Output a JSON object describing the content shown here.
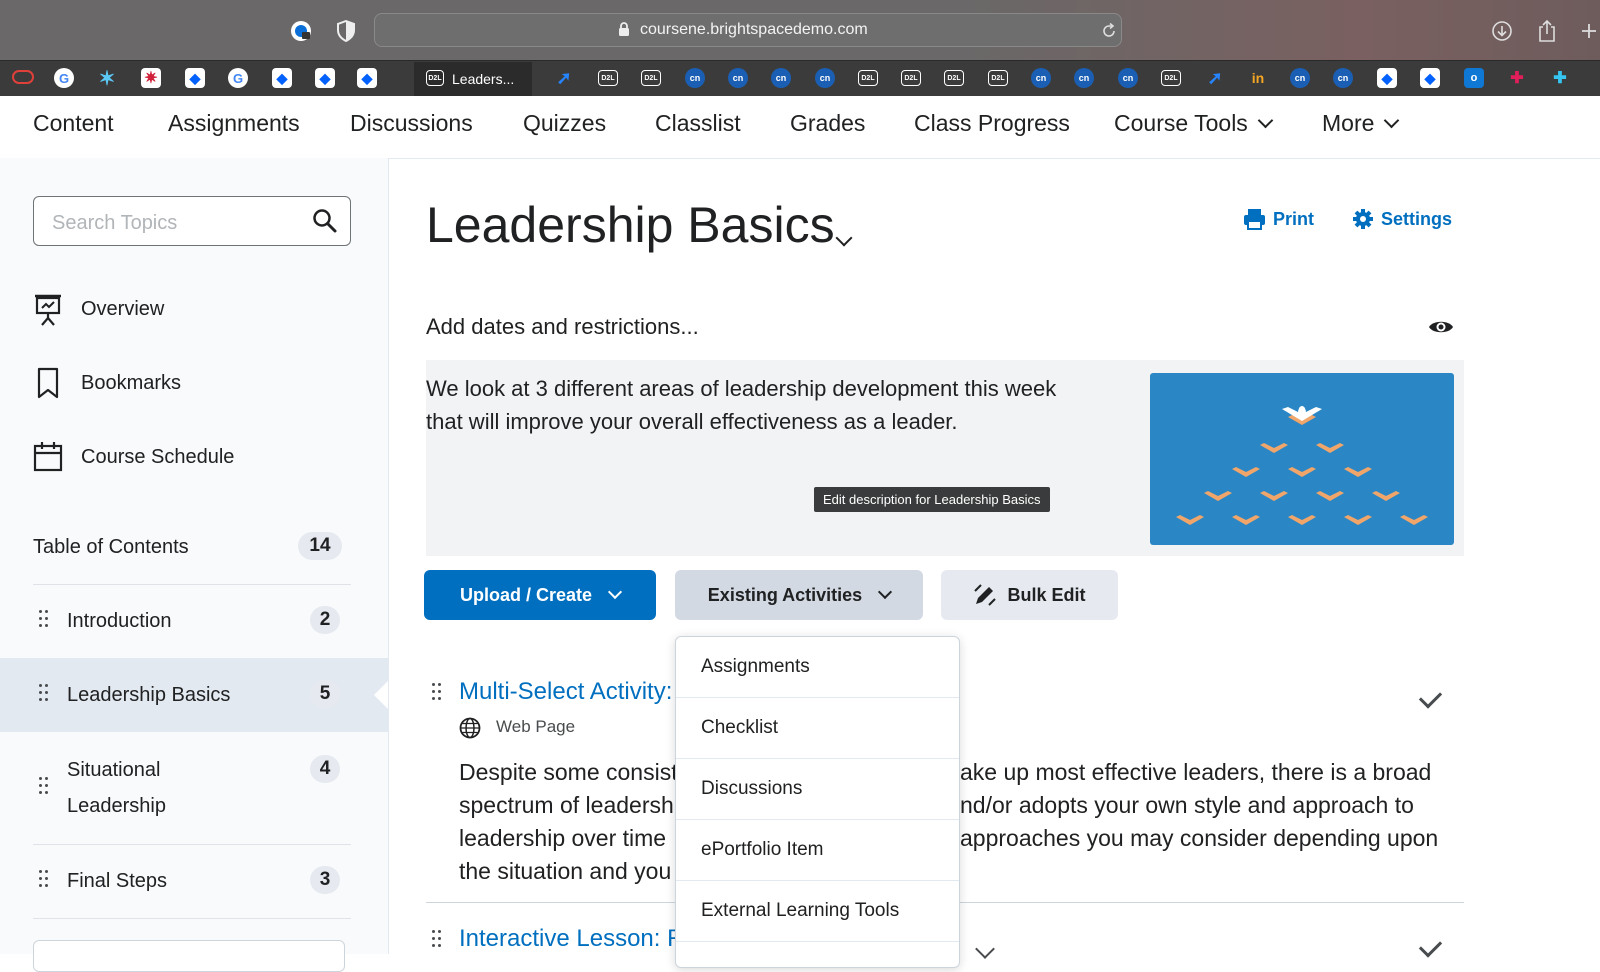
{
  "browser": {
    "url": "coursene.brightspacedemo.com",
    "active_tab_label": "Leaders...",
    "tab_icon_text": {
      "d2l": "D2L",
      "cn": "cn",
      "in": "in"
    }
  },
  "nav": {
    "items": [
      "Content",
      "Assignments",
      "Discussions",
      "Quizzes",
      "Classlist",
      "Grades",
      "Class Progress",
      "Course Tools",
      "More"
    ]
  },
  "sidebar": {
    "search_placeholder": "Search Topics",
    "links": [
      {
        "label": "Overview",
        "icon": "presentation-icon"
      },
      {
        "label": "Bookmarks",
        "icon": "bookmark-icon"
      },
      {
        "label": "Course Schedule",
        "icon": "calendar-icon"
      }
    ],
    "toc": {
      "label": "Table of Contents",
      "count": "14"
    },
    "units": [
      {
        "label": "Introduction",
        "count": "2"
      },
      {
        "label": "Leadership Basics",
        "count": "5",
        "selected": true
      },
      {
        "label_line1": "Situational",
        "label_line2": "Leadership",
        "count": "4"
      },
      {
        "label": "Final Steps",
        "count": "3"
      }
    ]
  },
  "main": {
    "title": "Leadership Basics",
    "print_label": "Print",
    "settings_label": "Settings",
    "dates_label": "Add dates and restrictions...",
    "description_line1": "We look at 3 different areas of leadership development this week",
    "description_line2": "that will improve your overall effectiveness as a leader.",
    "tooltip": "Edit description for Leadership Basics",
    "buttons": {
      "upload": "Upload / Create",
      "existing": "Existing Activities",
      "bulk": "Bulk Edit"
    },
    "topics": [
      {
        "title": "Multi-Select Activity:",
        "type": "Web Page",
        "body_left": [
          "Despite some consist",
          "spectrum of leadersh",
          "leadership over time",
          "the situation and you"
        ],
        "body_right": [
          "ake up most effective leaders, there is a broad",
          "nd/or adopts your own style and approach to",
          "approaches you may consider depending upon"
        ]
      },
      {
        "title": "Interactive Lesson: R"
      }
    ]
  },
  "dropdown": {
    "items": [
      "Assignments",
      "Checklist",
      "Discussions",
      "ePortfolio Item",
      "External Learning Tools"
    ]
  },
  "colors": {
    "brand_blue": "#006fbf",
    "nav_text": "#202122",
    "sidebar_bg": "#f9fafb",
    "selected_bg": "#e3e9f1"
  }
}
